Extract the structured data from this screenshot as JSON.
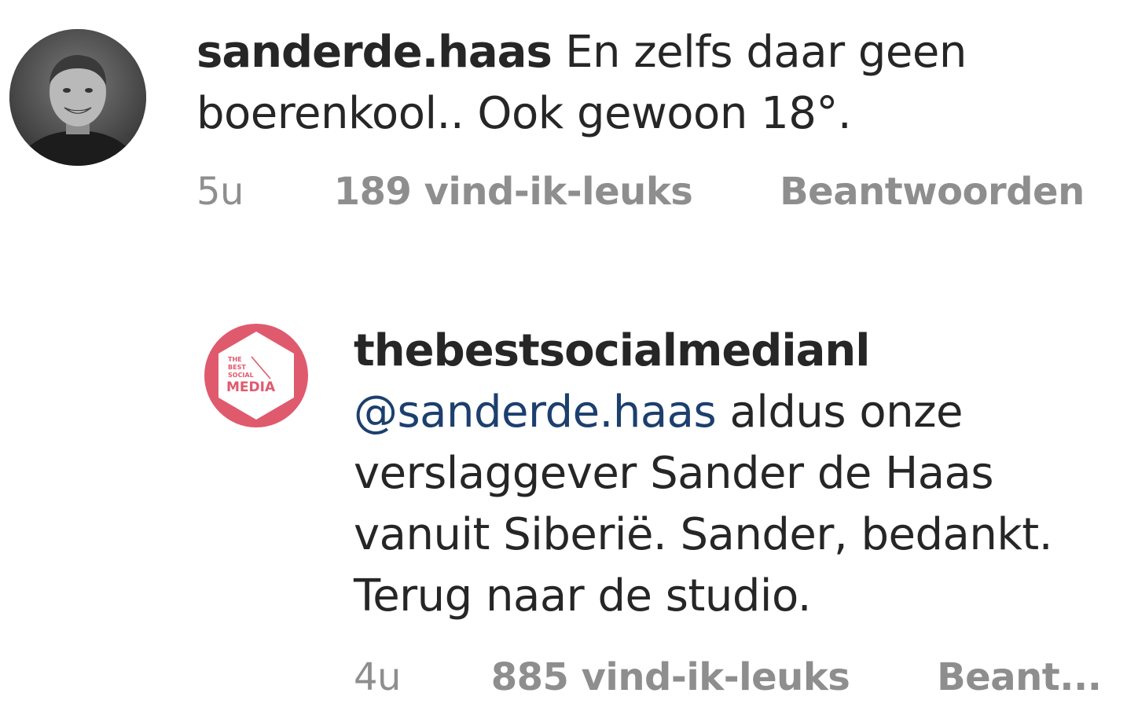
{
  "comments": [
    {
      "username": "sanderde.haas",
      "text": "En zelfs daar geen boerenkool.. Ook gewoon 18°.",
      "time": "5u",
      "likes": "189 vind-ik-leuks",
      "reply": "Beantwoorden"
    },
    {
      "username": "thebestsocialmedianl",
      "mention": "@sanderde.haas",
      "text": "aldus onze verslaggever Sander de Haas vanuit Siberië. Sander, bedankt. Terug naar de studio.",
      "time": "4u",
      "likes": "885 vind-ik-leuks",
      "reply": "Beant..."
    }
  ],
  "logo": {
    "line1": "THE",
    "line2": "BEST",
    "line3": "SOCIAL",
    "line4": "MEDIA",
    "color": "#e05a6e"
  }
}
